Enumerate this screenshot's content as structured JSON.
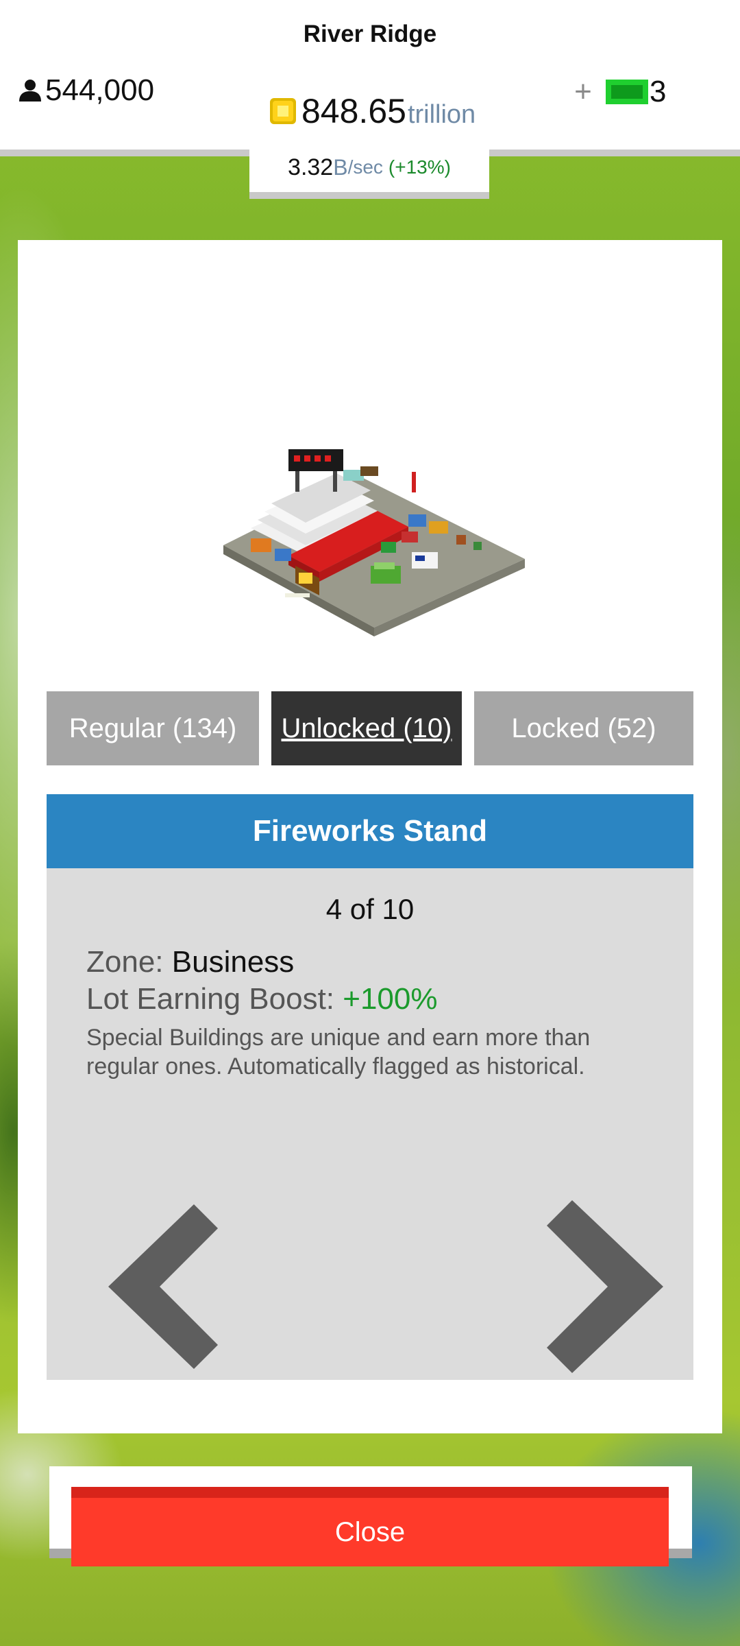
{
  "header": {
    "city_name": "River Ridge",
    "population": "544,000",
    "money_value": "848.65",
    "money_unit": "trillion",
    "rate_value": "3.32",
    "rate_unit": "B",
    "rate_suffix": "/sec",
    "rate_bonus": "(+13%)",
    "plus_label": "+",
    "cash_count": "3"
  },
  "tabs": [
    {
      "label": "Regular (134)"
    },
    {
      "label": "Unlocked (10)"
    },
    {
      "label": "Locked (52)"
    }
  ],
  "building": {
    "name": "Fireworks Stand",
    "counter": "4 of 10",
    "zone_label": "Zone: ",
    "zone_value": "Business",
    "boost_label": "Lot Earning Boost: ",
    "boost_value": "+100%",
    "description": "Special Buildings are unique and earn more than regular ones. Automatically flagged as historical."
  },
  "close_label": "Close",
  "colors": {
    "title_bar": "#2b85c2",
    "selected_tab": "#333333",
    "tab": "#a6a6a6",
    "close": "#ff3a2a",
    "boost": "#1b9a2c"
  },
  "icons": [
    "person-icon",
    "coin-icon",
    "cash-icon",
    "arrow-left-icon",
    "arrow-right-icon"
  ]
}
